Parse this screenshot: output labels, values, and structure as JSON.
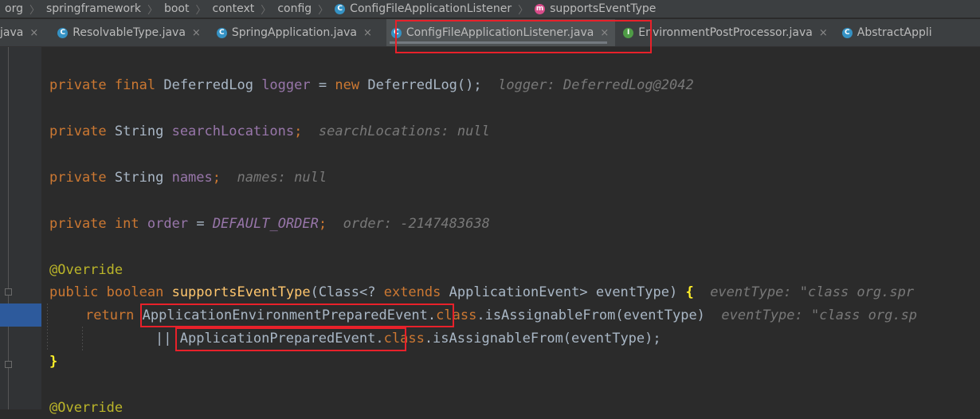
{
  "breadcrumb": {
    "items": [
      "org",
      "springframework",
      "boot",
      "context",
      "config"
    ],
    "class_name": "ConfigFileApplicationListener",
    "method_name": "supportsEventType",
    "class_icon": "C",
    "method_icon": "m"
  },
  "tabs": [
    {
      "label": "java",
      "icon": "",
      "close": "×"
    },
    {
      "label": "ResolvableType.java",
      "icon": "C",
      "close": "×"
    },
    {
      "label": "SpringApplication.java",
      "icon": "C",
      "close": "×"
    },
    {
      "label": "ConfigFileApplicationListener.java",
      "icon": "C",
      "close": "×",
      "active": true
    },
    {
      "label": "EnvironmentPostProcessor.java",
      "icon": "I",
      "close": "×"
    },
    {
      "label": "AbstractAppli",
      "icon": "C",
      "close": ""
    }
  ],
  "code": {
    "l1": {
      "kw1": "private",
      "kw2": "final",
      "type": "DeferredLog",
      "name": "logger",
      "op": "=",
      "kw3": "new",
      "expr": "DeferredLog();",
      "hint": "logger: DeferredLog@2042"
    },
    "l2": {
      "kw1": "private",
      "type": "String",
      "name": "searchLocations",
      "semi": ";",
      "hint": "searchLocations: null"
    },
    "l3": {
      "kw1": "private",
      "type": "String",
      "name": "names",
      "semi": ";",
      "hint": "names: null"
    },
    "l4": {
      "kw1": "private",
      "kw2": "int",
      "name": "order",
      "op": "=",
      "const": "DEFAULT_ORDER",
      "semi": ";",
      "hint": "order: -2147483638"
    },
    "l5": {
      "annotation": "@Override"
    },
    "l6": {
      "kw1": "public",
      "kw2": "boolean",
      "method": "supportsEventType",
      "p1": "(Class<?",
      "kw3": "extends",
      "p2": "ApplicationEvent> eventType)",
      "brace": "{",
      "hint": "eventType: \"class org.spr"
    },
    "l7": {
      "kw": "return",
      "type": "ApplicationEnvironmentPreparedEvent",
      "dot": ".",
      "kw2": "class",
      "call": ".isAssignableFrom(eventType)",
      "hint": "eventType: \"class org.sp"
    },
    "l8": {
      "op": "||",
      "type": "ApplicationPreparedEvent",
      "dot": ".",
      "kw2": "class",
      "call": ".isAssignableFrom(eventType);"
    },
    "l9": {
      "brace": "}"
    },
    "l10": {
      "annotation": "@Override"
    }
  },
  "colors": {
    "highlight_row": "#2d5a9c",
    "annotation_box": "#e8212a",
    "keyword": "#cc7832",
    "field": "#9876aa",
    "method": "#ffc66d"
  }
}
